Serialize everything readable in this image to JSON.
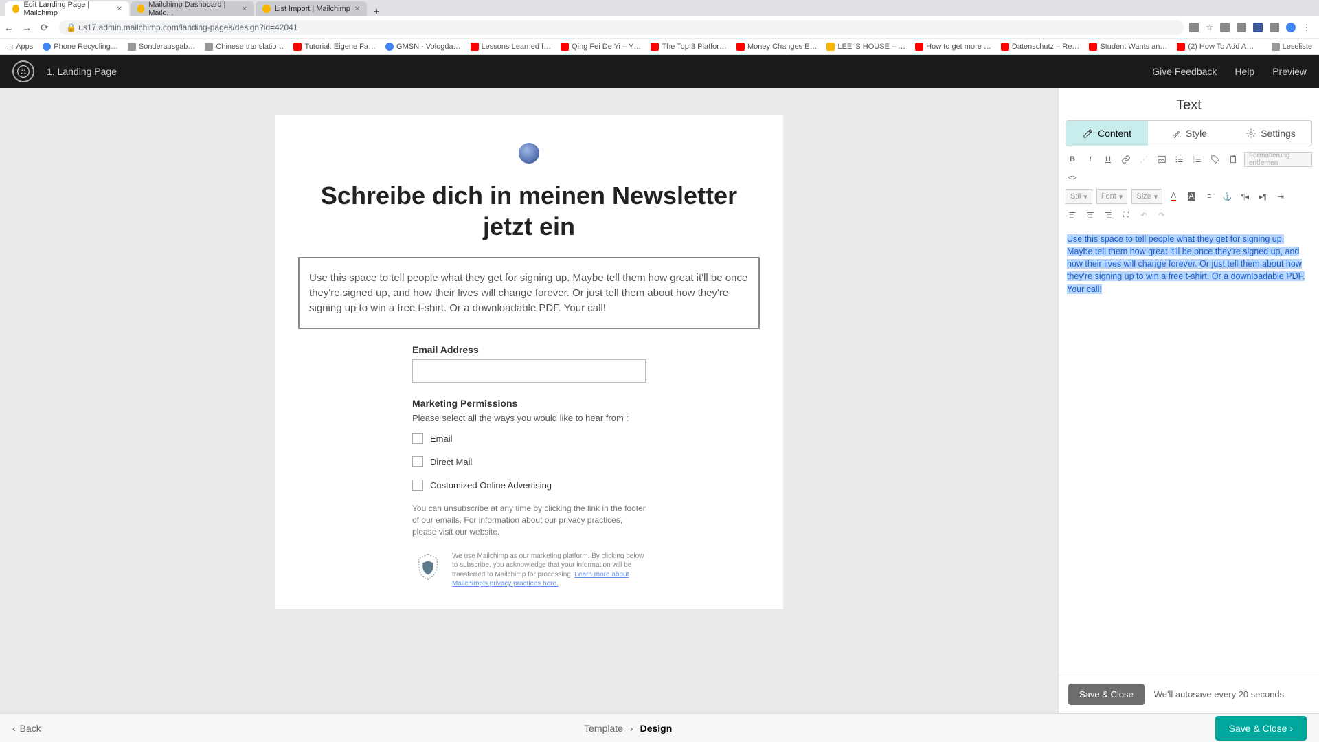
{
  "browser": {
    "tabs": [
      {
        "title": "Edit Landing Page | Mailchimp",
        "active": true
      },
      {
        "title": "Mailchimp Dashboard | Mailc…",
        "active": false
      },
      {
        "title": "List Import | Mailchimp",
        "active": false
      }
    ],
    "url": "us17.admin.mailchimp.com/landing-pages/design?id=42041",
    "bookmarks": [
      "Apps",
      "Phone Recycling…",
      "Sonderausgab…",
      "Chinese translatio…",
      "Tutorial: Eigene Fa…",
      "GMSN - Vologda…",
      "Lessons Learned f…",
      "Qing Fei De Yi – Y…",
      "The Top 3 Platfor…",
      "Money Changes E…",
      "LEE 'S HOUSE – …",
      "How to get more …",
      "Datenschutz – Re…",
      "Student Wants an…",
      "(2) How To Add A…",
      "Leseliste"
    ]
  },
  "header": {
    "step": "1. Landing Page",
    "feedback": "Give Feedback",
    "help": "Help",
    "preview": "Preview"
  },
  "page": {
    "headline": "Schreibe dich in meinen Newsletter jetzt ein",
    "description": "Use this space to tell people what they get for signing up. Maybe tell them how great it'll be once they're signed up, and how their lives will change forever. Or just tell them about how they're signing up to win a free t-shirt. Or a downloadable PDF. Your call!",
    "email_label": "Email Address",
    "perm_title": "Marketing Permissions",
    "perm_sub": "Please select all the ways you would like to hear from :",
    "opts": [
      "Email",
      "Direct Mail",
      "Customized Online Advertising"
    ],
    "unsub": "You can unsubscribe at any time by clicking the link in the footer of our emails. For information about our privacy practices, please visit our website.",
    "legal_pre": "We use Mailchimp as our marketing platform. By clicking below to subscribe, you acknowledge that your information will be transferred to Mailchimp for processing. ",
    "legal_link": "Learn more about Mailchimp's privacy practices here."
  },
  "sidebar": {
    "title": "Text",
    "tabs": {
      "content": "Content",
      "style": "Style",
      "settings": "Settings"
    },
    "clearfmt": "Formatierung entfernen",
    "sel_style": "Stil",
    "sel_font": "Font",
    "sel_size": "Size",
    "editor_text": "Use this space to tell people what they get for signing up. Maybe tell them how great it'll be once they're signed up, and how their lives will change forever. Or just tell them about how they're signing up to win a free t-shirt. Or a downloadable PDF. Your call!",
    "save_close": "Save & Close",
    "autosave": "We'll autosave every 20 seconds"
  },
  "footer": {
    "back": "Back",
    "step_template": "Template",
    "step_design": "Design",
    "save_close": "Save & Close ›"
  }
}
